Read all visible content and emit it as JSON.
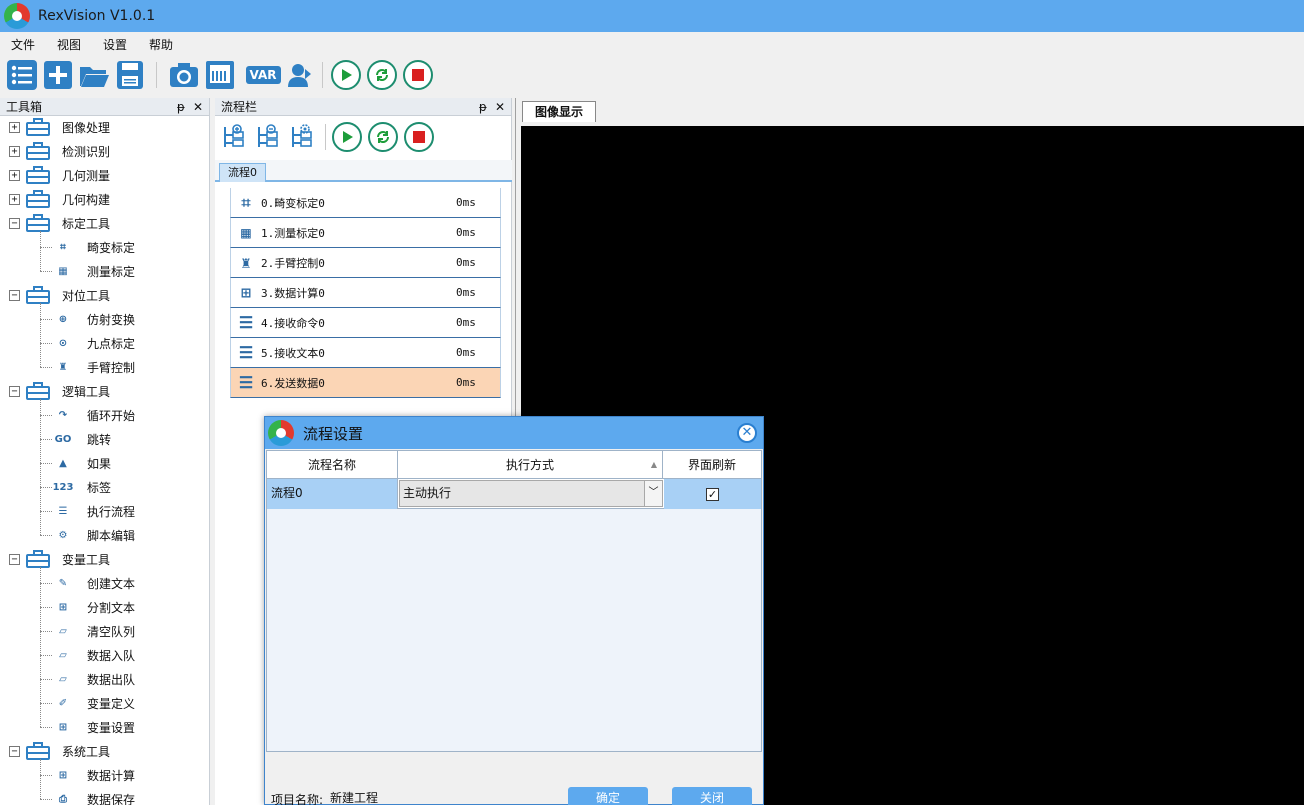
{
  "app": {
    "title": "RexVision V1.0.1"
  },
  "menu": [
    "文件",
    "视图",
    "设置",
    "帮助"
  ],
  "toolbar": {
    "icons": [
      "list-icon",
      "new-icon",
      "open-folder-icon",
      "save-icon",
      "camera-icon",
      "image-icon",
      "var-icon",
      "user-icon",
      "run-icon",
      "loop-icon",
      "stop-icon"
    ],
    "var_label": "VAR"
  },
  "toolbox": {
    "title": "工具箱",
    "pin": "📌",
    "close": "✕",
    "groups": [
      {
        "label": "图像处理",
        "expander": "+"
      },
      {
        "label": "检测识别",
        "expander": "+"
      },
      {
        "label": "几何测量",
        "expander": "+"
      },
      {
        "label": "几何构建",
        "expander": "+"
      },
      {
        "label": "标定工具",
        "expander": "−",
        "children": [
          "畸变标定",
          "测量标定"
        ]
      },
      {
        "label": "对位工具",
        "expander": "−",
        "children": [
          "仿射变换",
          "九点标定",
          "手臂控制"
        ]
      },
      {
        "label": "逻辑工具",
        "expander": "−",
        "children": [
          "循环开始",
          "跳转",
          "如果",
          "标签",
          "执行流程",
          "脚本编辑"
        ]
      },
      {
        "label": "变量工具",
        "expander": "−",
        "children": [
          "创建文本",
          "分割文本",
          "清空队列",
          "数据入队",
          "数据出队",
          "变量定义",
          "变量设置"
        ]
      },
      {
        "label": "系统工具",
        "expander": "−",
        "children": [
          "数据计算",
          "数据保存"
        ]
      }
    ]
  },
  "flowpanel": {
    "title": "流程栏",
    "tab": "流程0",
    "items": [
      {
        "name": "0.畸变标定0",
        "time": "0ms"
      },
      {
        "name": "1.测量标定0",
        "time": "0ms"
      },
      {
        "name": "2.手臂控制0",
        "time": "0ms"
      },
      {
        "name": "3.数据计算0",
        "time": "0ms"
      },
      {
        "name": "4.接收命令0",
        "time": "0ms"
      },
      {
        "name": "5.接收文本0",
        "time": "0ms"
      },
      {
        "name": "6.发送数据0",
        "time": "0ms"
      }
    ],
    "selected_index": 6
  },
  "image_panel": {
    "tab": "图像显示"
  },
  "dialog": {
    "title": "流程设置",
    "columns": [
      "流程名称",
      "执行方式",
      "界面刷新"
    ],
    "rows": [
      {
        "name": "流程0",
        "mode": "主动执行",
        "refresh": "☑"
      }
    ],
    "project_label": "项目名称:",
    "project_value": "新建工程",
    "ok": "确定",
    "close": "关闭"
  },
  "colors": {
    "titlebar": "#5da9ee",
    "accent_green": "#1d8d6f",
    "stop_red": "#d92020",
    "selection": "#fbd5b5"
  }
}
